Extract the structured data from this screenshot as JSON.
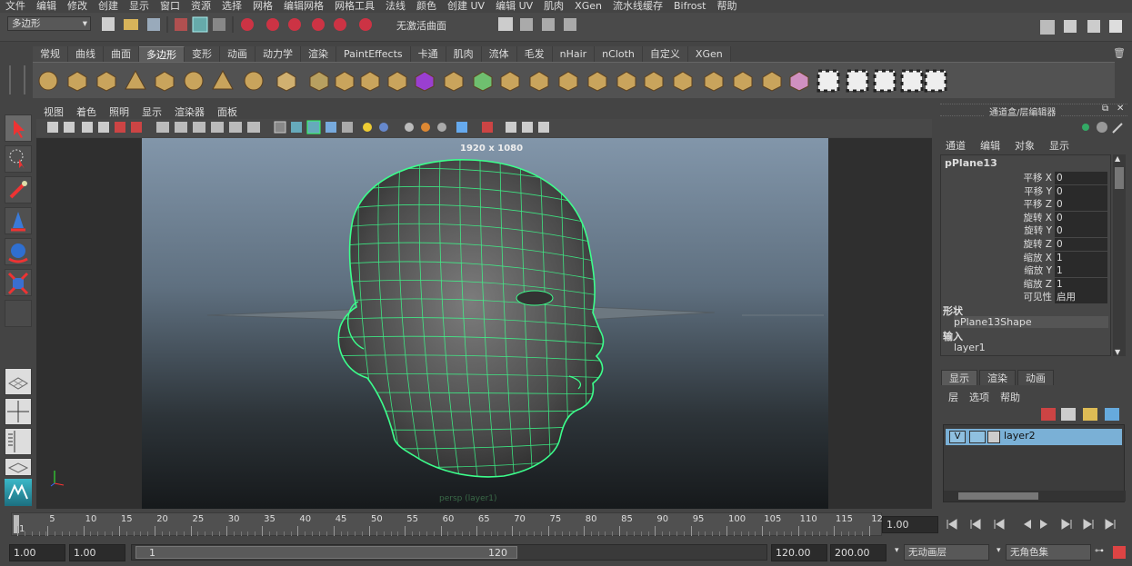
{
  "menubar": [
    "文件",
    "编辑",
    "修改",
    "创建",
    "显示",
    "窗口",
    "资源",
    "选择",
    "网格",
    "编辑网格",
    "网格工具",
    "法线",
    "颜色",
    "创建 UV",
    "编辑 UV",
    "肌肉",
    "XGen",
    "流水线缓存",
    "Bifrost",
    "帮助"
  ],
  "status": {
    "menuset": "多边形",
    "live_surface": "无激活曲面"
  },
  "shelf_tabs": [
    "常规",
    "曲线",
    "曲面",
    "多边形",
    "变形",
    "动画",
    "动力学",
    "渲染",
    "PaintEffects",
    "卡通",
    "肌肉",
    "流体",
    "毛发",
    "nHair",
    "nCloth",
    "自定义",
    "XGen"
  ],
  "shelf_active": 3,
  "viewport": {
    "menu": [
      "视图",
      "着色",
      "照明",
      "显示",
      "渲染器",
      "面板"
    ],
    "resolution": "1920 x 1080",
    "camera": "persp (layer1)"
  },
  "channelbox": {
    "title": "通道盒/层编辑器",
    "menu": [
      "通道",
      "编辑",
      "对象",
      "显示"
    ],
    "object": "pPlane13",
    "attrs": [
      {
        "k": "平移 X",
        "v": "0"
      },
      {
        "k": "平移 Y",
        "v": "0"
      },
      {
        "k": "平移 Z",
        "v": "0"
      },
      {
        "k": "旋转 X",
        "v": "0"
      },
      {
        "k": "旋转 Y",
        "v": "0"
      },
      {
        "k": "旋转 Z",
        "v": "0"
      },
      {
        "k": "缩放 X",
        "v": "1"
      },
      {
        "k": "缩放 Y",
        "v": "1"
      },
      {
        "k": "缩放 Z",
        "v": "1"
      },
      {
        "k": "可见性",
        "v": "启用"
      }
    ],
    "shapes_label": "形状",
    "shape": "pPlane13Shape",
    "inputs_label": "输入",
    "input": "layer1"
  },
  "layers": {
    "tabs": [
      "显示",
      "渲染",
      "动画"
    ],
    "menu": [
      "层",
      "选项",
      "帮助"
    ],
    "layer_vis": "V",
    "layer_name": "layer2"
  },
  "timeline": {
    "ticks": [
      "1",
      "5",
      "10",
      "15",
      "20",
      "25",
      "30",
      "35",
      "40",
      "45",
      "50",
      "55",
      "60",
      "65",
      "70",
      "75",
      "80",
      "85",
      "90",
      "95",
      "100",
      "105",
      "110",
      "115",
      "12"
    ],
    "current": "1.00"
  },
  "range": {
    "start": "1.00",
    "anim_start": "1.00",
    "slider_start": "1",
    "slider_end": "120",
    "end": "120.00",
    "anim_end": "200.00",
    "anim_layer": "无动画层",
    "char_set": "无角色集"
  },
  "colors": {
    "wire": "#3cff8c",
    "accent": "#7ab0d6"
  }
}
